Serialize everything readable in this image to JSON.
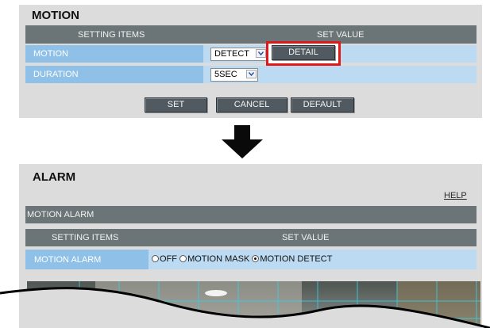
{
  "motion_panel": {
    "title": "MOTION",
    "header": {
      "setting_items": "SETTING ITEMS",
      "set_value": "SET VALUE"
    },
    "rows": [
      {
        "label": "MOTION",
        "select_value": "DETECT",
        "button": "DETAIL"
      },
      {
        "label": "DURATION",
        "select_value": "5SEC"
      }
    ],
    "buttons": {
      "set": "SET",
      "cancel": "CANCEL",
      "default": "DEFAULT"
    }
  },
  "alarm_panel": {
    "title": "ALARM",
    "help": "HELP",
    "section": "MOTION ALARM",
    "header": {
      "setting_items": "SETTING ITEMS",
      "set_value": "SET VALUE"
    },
    "row_label": "MOTION ALARM",
    "options": [
      {
        "label": "OFF",
        "selected": false
      },
      {
        "label": "MOTION MASK",
        "selected": false
      },
      {
        "label": "MOTION DETECT",
        "selected": true
      }
    ]
  },
  "colors": {
    "panel_bg": "#dcdcdc",
    "header_bg": "#6b7476",
    "row_label_bg": "#8fc0e8",
    "row_value_bg": "#bcdaf2",
    "highlight": "#e01818"
  }
}
